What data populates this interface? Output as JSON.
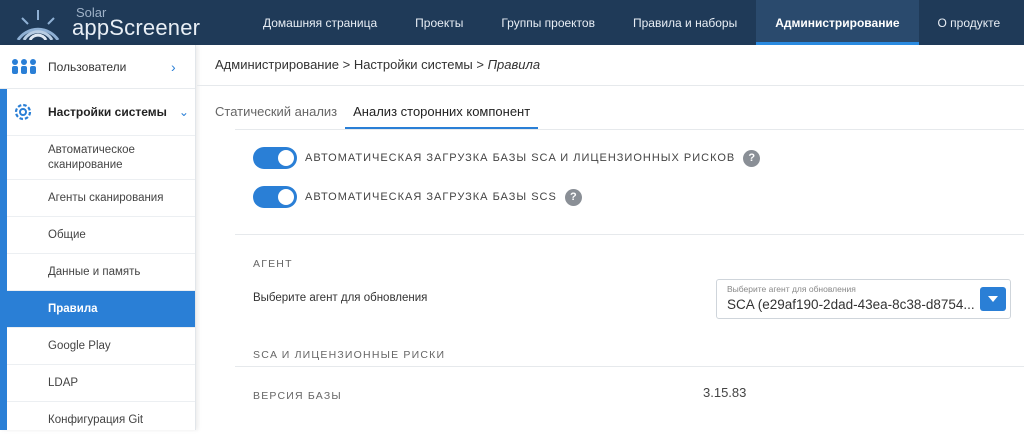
{
  "logo": {
    "small": "Solar",
    "big": "appScreener"
  },
  "nav": [
    {
      "label": "Домашняя страница"
    },
    {
      "label": "Проекты"
    },
    {
      "label": "Группы проектов"
    },
    {
      "label": "Правила и наборы"
    },
    {
      "label": "Администрирование",
      "active": true
    },
    {
      "label": "О продукте"
    }
  ],
  "sidebar": {
    "users": {
      "label": "Пользователи",
      "chevron": "›"
    },
    "settings": {
      "label": "Настройки системы",
      "chevron": "⌄"
    },
    "items": [
      {
        "label": "Автоматическое сканирование"
      },
      {
        "label": "Агенты сканирования"
      },
      {
        "label": "Общие"
      },
      {
        "label": "Данные и память"
      },
      {
        "label": "Правила",
        "active": true
      },
      {
        "label": "Google Play"
      },
      {
        "label": "LDAP"
      },
      {
        "label": "Конфигурация Git"
      }
    ]
  },
  "breadcrumb": {
    "part1": "Администрирование",
    "sep": ">",
    "part2": "Настройки системы",
    "part3": "Правила"
  },
  "tabs": [
    {
      "label": "Статический анализ"
    },
    {
      "label": "Анализ сторонних компонент",
      "active": true
    }
  ],
  "toggles": [
    {
      "label": "АВТОМАТИЧЕСКАЯ ЗАГРУЗКА БАЗЫ SCA И ЛИЦЕНЗИОННЫХ РИСКОВ",
      "on": true,
      "help": "?"
    },
    {
      "label": "АВТОМАТИЧЕСКАЯ ЗАГРУЗКА БАЗЫ SCS",
      "on": true,
      "help": "?"
    }
  ],
  "agent": {
    "section_title": "АГЕНТ",
    "field_label": "Выберите агент для обновления",
    "select_placeholder": "Выберите агент для обновления",
    "select_value": "SCA (e29af190-2dad-43ea-8c38-d8754..."
  },
  "sca": {
    "section_title": "SCA И ЛИЦЕНЗИОННЫЕ РИСКИ",
    "version_label": "ВЕРСИЯ БАЗЫ",
    "version_value": "3.15.83"
  },
  "colors": {
    "topbar": "#1f3a58",
    "accent": "#2a7fd6"
  }
}
